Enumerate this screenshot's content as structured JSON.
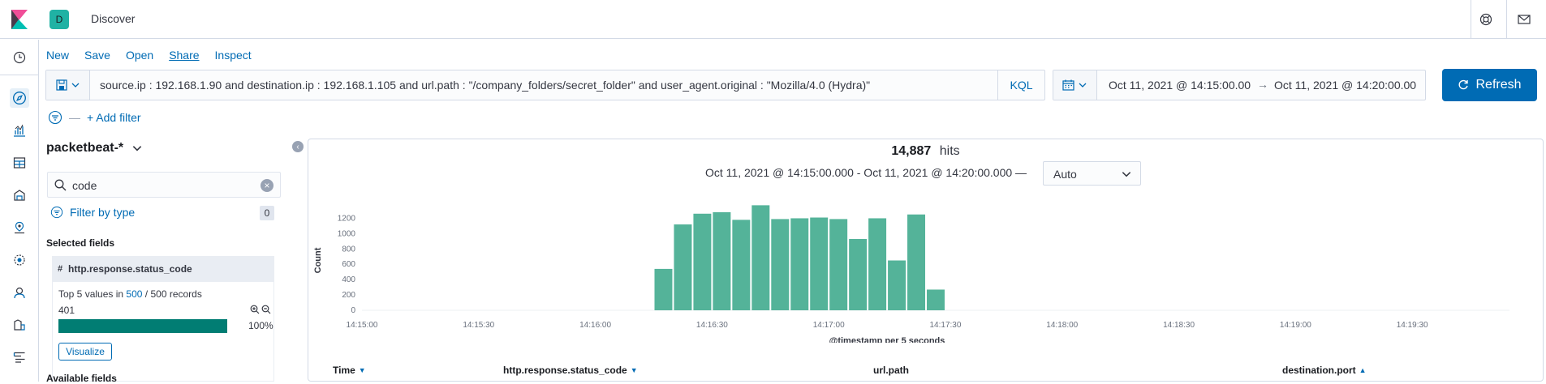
{
  "header": {
    "space_initial": "D",
    "app_title": "Discover",
    "help_icon": "help-icon",
    "mail_icon": "newsfeed-icon"
  },
  "sidenav": {
    "icons": [
      "recently-viewed-icon",
      "discover-icon",
      "visualize-icon",
      "dashboard-icon",
      "canvas-icon",
      "maps-icon",
      "ml-icon",
      "siem-icon",
      "apm-icon",
      "logs-icon"
    ]
  },
  "menu": {
    "new": "New",
    "save": "Save",
    "open": "Open",
    "share": "Share",
    "inspect": "Inspect"
  },
  "query": {
    "text": "source.ip : 192.168.1.90 and destination.ip : 192.168.1.105 and url.path : \"/company_folders/secret_folder\" and user_agent.original : \"Mozilla/4.0 (Hydra)\"",
    "language": "KQL"
  },
  "datepicker": {
    "start": "Oct 11, 2021 @ 14:15:00.00",
    "arrow": "→",
    "end": "Oct 11, 2021 @ 14:20:00.00"
  },
  "refresh_label": "Refresh",
  "filters": {
    "dash": "—",
    "add_filter": "+ Add filter"
  },
  "sidebar": {
    "index_pattern": "packetbeat-*",
    "search_value": "code",
    "filter_by_type": "Filter by type",
    "filter_count": "0",
    "selected_fields_title": "Selected fields",
    "selected_field": {
      "type_glyph": "#",
      "name": "http.response.status_code",
      "top5_prefix": "Top 5 values in",
      "top5_count": "500",
      "top5_sep": "/",
      "top5_suffix": "500 records",
      "values": [
        {
          "label": "401",
          "percent_text": "100%",
          "fraction": 1.0
        }
      ],
      "visualize": "Visualize"
    },
    "available_fields_title": "Available fields"
  },
  "main": {
    "hits_count": "14,887",
    "hits_label": "hits",
    "time_range": "Oct 11, 2021 @ 14:15:00.000 - Oct 11, 2021 @ 14:20:00.000 —",
    "interval": "Auto",
    "columns": [
      {
        "label": "Time",
        "sort": "▼"
      },
      {
        "label": "http.response.status_code",
        "sort": "▼"
      },
      {
        "label": "url.path",
        "sort": ""
      },
      {
        "label": "destination.port",
        "sort": "▲"
      }
    ]
  },
  "chart_data": {
    "type": "bar",
    "title": "",
    "xlabel": "@timestamp per 5 seconds",
    "ylabel": "Count",
    "color": "#54b399",
    "ylim": [
      0,
      1300
    ],
    "yticks": [
      0,
      200,
      400,
      600,
      800,
      1000,
      1200
    ],
    "xlim_seconds": [
      "14:15:00",
      "14:19:50"
    ],
    "xticks": [
      "14:15:00",
      "14:15:30",
      "14:16:00",
      "14:16:30",
      "14:17:00",
      "14:17:30",
      "14:18:00",
      "14:18:30",
      "14:19:00",
      "14:19:30"
    ],
    "categories": [
      "14:16:15",
      "14:16:20",
      "14:16:25",
      "14:16:30",
      "14:16:35",
      "14:16:40",
      "14:16:45",
      "14:16:50",
      "14:16:55",
      "14:17:00",
      "14:17:05",
      "14:17:10",
      "14:17:15",
      "14:17:20",
      "14:17:25"
    ],
    "values": [
      540,
      1120,
      1260,
      1280,
      1180,
      1370,
      1190,
      1200,
      1210,
      1190,
      930,
      1200,
      650,
      1250,
      270
    ],
    "grid": false,
    "legend": "none"
  }
}
